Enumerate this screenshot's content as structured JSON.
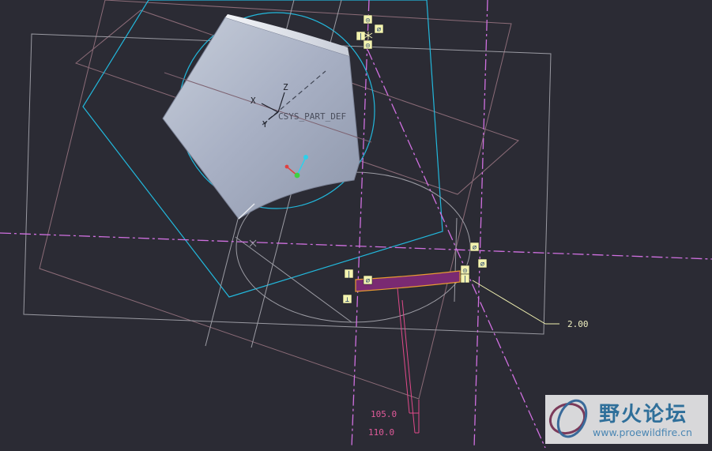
{
  "canvas": {
    "background": "#2b2b34",
    "csys_label": "CSYS_PART_DEF",
    "axis_x": "X",
    "axis_y": "Y",
    "axis_z": "Z"
  },
  "dimensions": {
    "thickness": "2.00",
    "angle_a": "105.0",
    "angle_b": "110.0"
  },
  "constraint_symbols": {
    "perpendicular": "⊥",
    "vertical": "|",
    "tangent": "⌀",
    "equal": "◎"
  },
  "colors": {
    "solid_face": "#a8b0c4",
    "cyan_geometry": "#22b8dc",
    "datum_plane": "#8c6c78",
    "centerline": "#d070e0",
    "sketch_fill": "#7a2a72",
    "sketch_edge": "#e89a32",
    "dimension": "#e04a8a",
    "dimension_leader": "#f0f0b0",
    "constraint_box": "#f4f4b0"
  },
  "watermark": {
    "title": "野火论坛",
    "url": "www.proewildfire.cn"
  }
}
